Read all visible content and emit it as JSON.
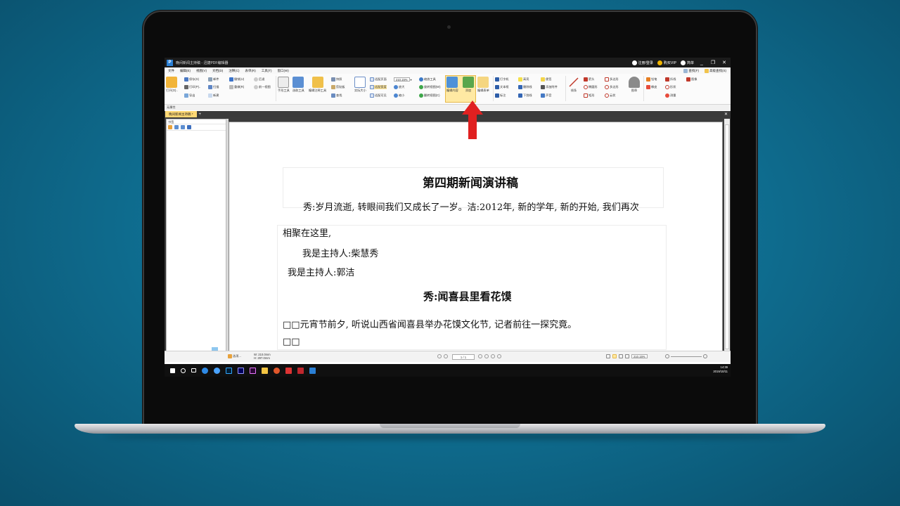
{
  "window": {
    "title": "晚间新闻主持稿 - 迅捷PDF编辑器",
    "login_label": "注册/登录",
    "vip_label": "购买VIP",
    "user_label": "简单",
    "minimize": "_",
    "restore": "❐",
    "close": "✕"
  },
  "menu": {
    "items": [
      "文件",
      "编辑(E)",
      "视图(V)",
      "文档(D)",
      "注释(C)",
      "表单(R)",
      "工具(T)",
      "窗口(W)"
    ],
    "right_items": [
      "查找(F)",
      "高级查找(S)"
    ]
  },
  "ribbon": {
    "open": "打开(O)..",
    "save": "保存(S)",
    "mail": "邮件",
    "print": "打印(P)..",
    "scan": "扫描",
    "export": "导出",
    "new": "新建",
    "undo": "撤销(U)",
    "redo": "重做(R)",
    "forward": "后退",
    "prev_view": "前一视图",
    "hand_tool": "手形工具",
    "select_tool": "选取工具",
    "edit_annot_tool": "编辑注释工具",
    "snapshot": "快照",
    "clipboard": "剪贴板",
    "find": "查找",
    "actual_size": "实际大小",
    "fit_page": "适配页面",
    "fit_width": "适配宽度",
    "fit_visible": "适配可见",
    "zoom_value": "210.15%",
    "zoom_in": "放大",
    "zoom_out": "缩小",
    "zoom_tool": "缩放工具",
    "rotate_cw": "旋转视图(W)",
    "rotate_ccw": "翻转视图(C)",
    "edit_content": "编辑内容",
    "add": "添加",
    "edit_form": "编辑表单",
    "typewriter": "打字机",
    "textbox": "文本框",
    "callout": "标注",
    "highlight": "高亮",
    "strikeout": "删除线",
    "underline": "下划线",
    "sticky_note": "便签",
    "attach_file": "添加附件",
    "sound": "声音",
    "line": "线条",
    "arrow": "箭头",
    "ellipse": "椭圆形",
    "rectangle": "矩形",
    "polygon": "多边形",
    "polyline": "多边形",
    "cloud": "云状",
    "stamp": "图章",
    "pencil": "铅笔",
    "eraser": "橡皮",
    "shape": "形状",
    "line2": "折线",
    "measure": "测量",
    "image": "图像"
  },
  "status": {
    "properties": "无属性"
  },
  "tab": {
    "name": "晚间新闻主持稿 *",
    "add": "+",
    "close": "✕"
  },
  "side_panel": {
    "title": "书签"
  },
  "document": {
    "title": "第四期新闻演讲稿",
    "line1": "秀:岁月流逝, 转眼间我们又成长了一岁。洁:2012年, 新的学年, 新的开始, 我们再次",
    "line2": "相聚在这里,",
    "line3": "我是主持人:柴慧秀",
    "line4": "我是主持人:郭洁",
    "heading": "秀:闻喜县里看花馍",
    "line5": "□□元宵节前夕, 听说山西省闻喜县举办花馍文化节, 记者前往一探究竟。",
    "line6": "□□"
  },
  "bottom": {
    "select_label": "选项...",
    "page_size_w": "W: 210.0mm",
    "page_size_h": "H: 297.0mm",
    "page_indicator": "1 / 1",
    "zoom_value": "210.15%"
  },
  "taskbar": {
    "time": "14:39",
    "date": "2019/10/11"
  },
  "colors": {
    "accent_red": "#e02020",
    "highlight_yellow": "#ffe9a3",
    "tab_yellow": "#ffd873"
  }
}
